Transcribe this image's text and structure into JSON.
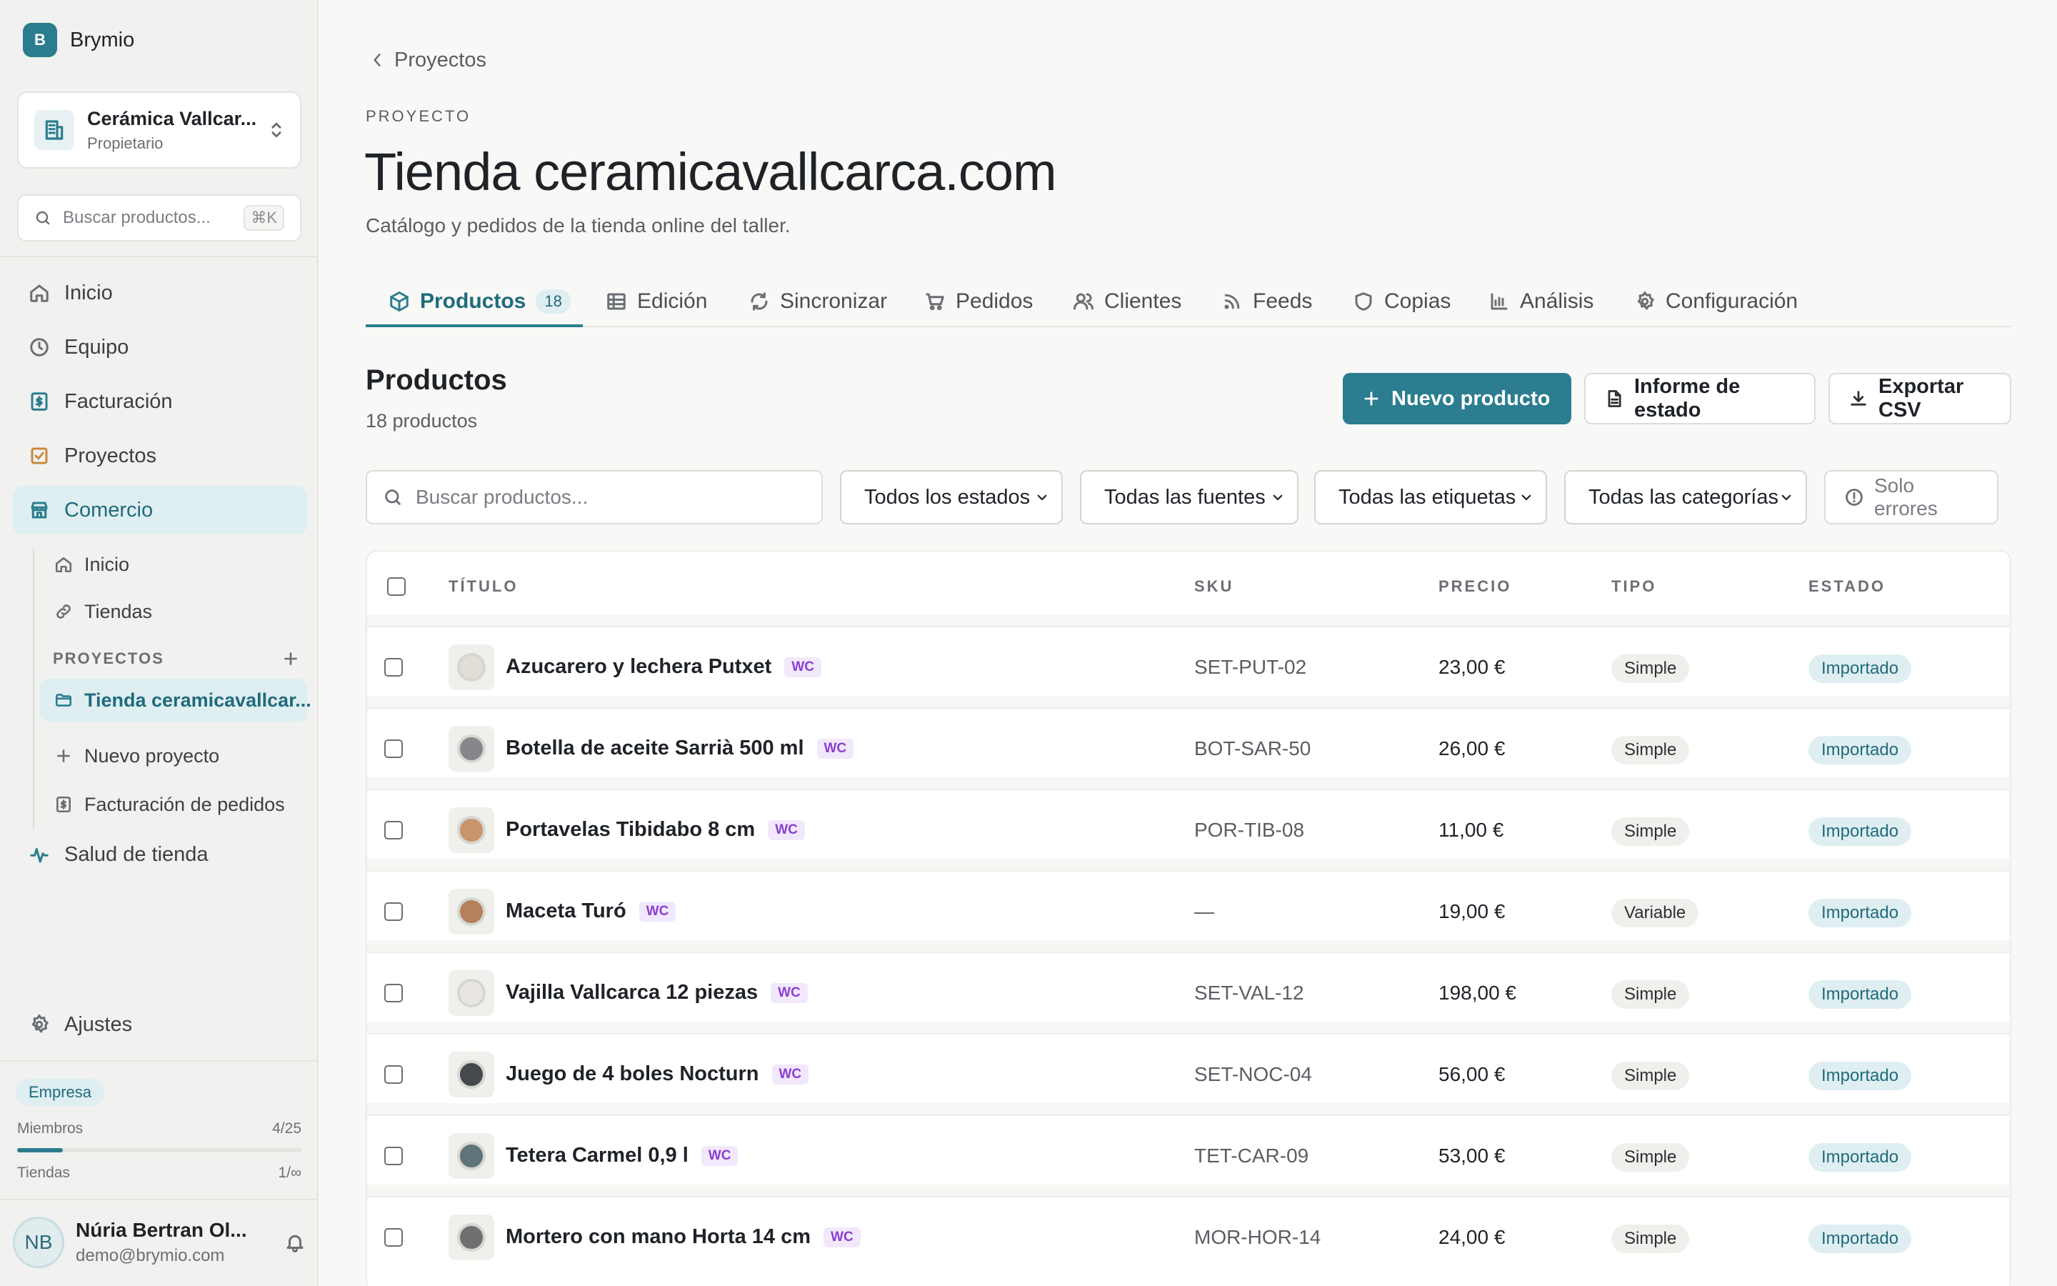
{
  "brand": {
    "logo_letter": "B",
    "name": "Brymio"
  },
  "workspace": {
    "name": "Cerámica Vallcar...",
    "role": "Propietario"
  },
  "sidebar_search": {
    "placeholder": "Buscar productos...",
    "shortcut": "⌘K"
  },
  "nav": [
    {
      "label": "Inicio",
      "icon": "home-icon"
    },
    {
      "label": "Equipo",
      "icon": "clock-icon"
    },
    {
      "label": "Facturación",
      "icon": "invoice-icon"
    },
    {
      "label": "Proyectos",
      "icon": "checkbox-icon"
    },
    {
      "label": "Comercio",
      "icon": "store-icon",
      "active": true
    }
  ],
  "commerce_sub": [
    {
      "label": "Inicio",
      "icon": "home-icon"
    },
    {
      "label": "Tiendas",
      "icon": "link-icon"
    }
  ],
  "projects_section": {
    "title": "PROYECTOS",
    "items": [
      {
        "label": "Tienda ceramicavallcar...",
        "icon": "folder-icon",
        "active": true
      },
      {
        "label": "Nuevo proyecto",
        "icon": "plus-icon"
      },
      {
        "label": "Facturación de pedidos",
        "icon": "invoice-icon"
      }
    ]
  },
  "nav_health": {
    "label": "Salud de tienda",
    "icon": "pulse-icon"
  },
  "nav_settings": {
    "label": "Ajustes",
    "icon": "gear-icon"
  },
  "plan": {
    "badge": "Empresa",
    "members_label": "Miembros",
    "members_value": "4/25",
    "members_fraction": 0.16,
    "stores_label": "Tiendas",
    "stores_value": "1/∞"
  },
  "user": {
    "initials": "NB",
    "name": "Núria Bertran Ol...",
    "email": "demo@brymio.com"
  },
  "breadcrumb": {
    "label": "Proyectos"
  },
  "page": {
    "eyebrow": "PROYECTO",
    "title": "Tienda ceramicavallcarca.com",
    "subtitle": "Catálogo y pedidos de la tienda online del taller."
  },
  "tabs": [
    {
      "label": "Productos",
      "count": "18",
      "icon": "box-icon",
      "active": true
    },
    {
      "label": "Edición",
      "icon": "table-icon"
    },
    {
      "label": "Sincronizar",
      "icon": "refresh-icon"
    },
    {
      "label": "Pedidos",
      "icon": "cart-icon"
    },
    {
      "label": "Clientes",
      "icon": "users-icon"
    },
    {
      "label": "Feeds",
      "icon": "rss-icon"
    },
    {
      "label": "Copias",
      "icon": "shield-icon"
    },
    {
      "label": "Análisis",
      "icon": "bar-chart-icon"
    },
    {
      "label": "Configuración",
      "icon": "gear-icon"
    }
  ],
  "section": {
    "title": "Productos",
    "count_text": "18 productos"
  },
  "actions": {
    "new_product": "Nuevo producto",
    "status_report": "Informe de estado",
    "export_csv": "Exportar CSV"
  },
  "filters": {
    "search_placeholder": "Buscar productos...",
    "status": "Todos los estados",
    "source": "Todas las fuentes",
    "tags": "Todas las etiquetas",
    "categories": "Todas las categorías",
    "errors_only": "Solo errores"
  },
  "table": {
    "columns": {
      "title": "TÍTULO",
      "sku": "SKU",
      "price": "PRECIO",
      "type": "TIPO",
      "status": "ESTADO"
    },
    "badge": "WC",
    "rows": [
      {
        "title": "Azucarero y lechera Putxet",
        "sku": "SET-PUT-02",
        "price": "23,00 €",
        "type": "Simple",
        "status": "Importado",
        "color": "#e2ddd6"
      },
      {
        "title": "Botella de aceite Sarrià 500 ml",
        "sku": "BOT-SAR-50",
        "price": "26,00 €",
        "type": "Simple",
        "status": "Importado",
        "color": "#85878a"
      },
      {
        "title": "Portavelas Tibidabo 8 cm",
        "sku": "POR-TIB-08",
        "price": "11,00 €",
        "type": "Simple",
        "status": "Importado",
        "color": "#c8946a"
      },
      {
        "title": "Maceta Turó",
        "sku": "—",
        "price": "19,00 €",
        "type": "Variable",
        "status": "Importado",
        "color": "#b4805e"
      },
      {
        "title": "Vajilla Vallcarca 12 piezas",
        "sku": "SET-VAL-12",
        "price": "198,00 €",
        "type": "Simple",
        "status": "Importado",
        "color": "#e9e6e1"
      },
      {
        "title": "Juego de 4 boles Nocturn",
        "sku": "SET-NOC-04",
        "price": "56,00 €",
        "type": "Simple",
        "status": "Importado",
        "color": "#45484c"
      },
      {
        "title": "Tetera Carmel 0,9 l",
        "sku": "TET-CAR-09",
        "price": "53,00 €",
        "type": "Simple",
        "status": "Importado",
        "color": "#5e737a"
      },
      {
        "title": "Mortero con mano Horta 14 cm",
        "sku": "MOR-HOR-14",
        "price": "24,00 €",
        "type": "Simple",
        "status": "Importado",
        "color": "#6f7072"
      }
    ]
  },
  "colors": {
    "accent": "#2b7d8f",
    "accent_soft": "#dfeef1",
    "wc_badge": "#8a3fd1"
  }
}
